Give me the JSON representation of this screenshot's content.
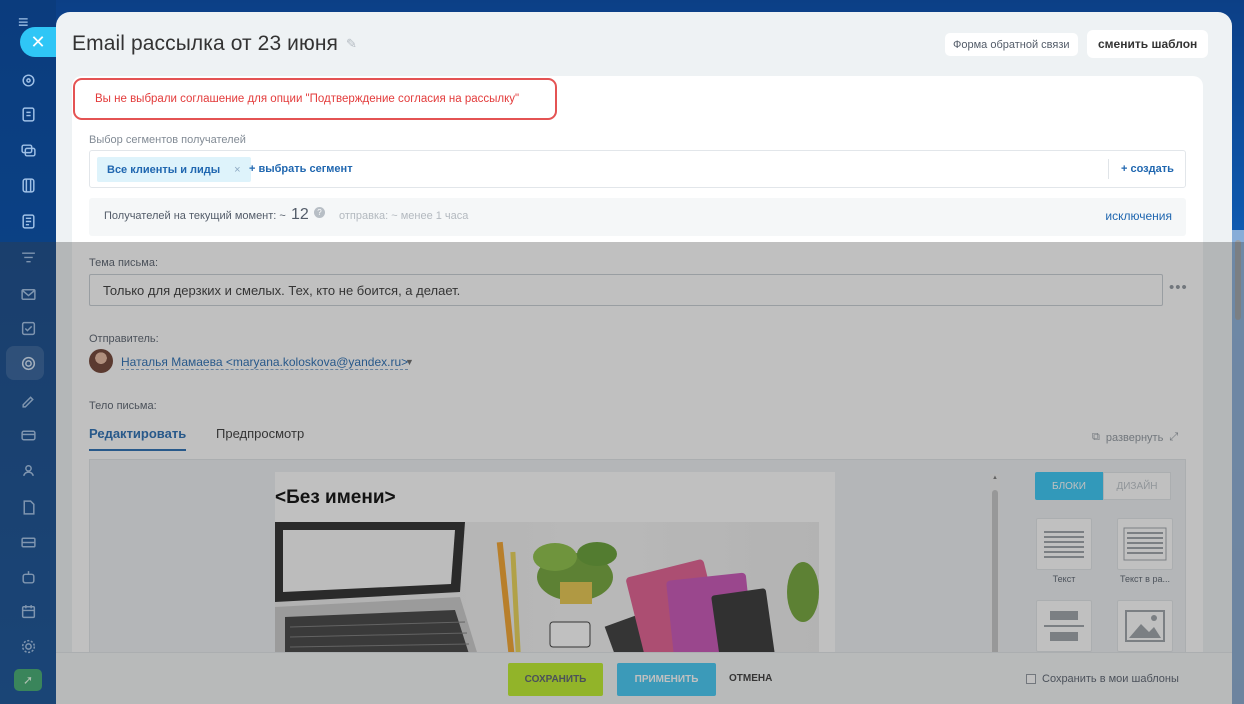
{
  "header": {
    "title": "Email рассылка от 23 июня",
    "feedback_label": "Форма обратной связи",
    "change_template_label": "сменить шаблон"
  },
  "error": {
    "message": "Вы не выбрали соглашение для опции \"Подтверждение согласия на рассылку\""
  },
  "segments": {
    "label": "Выбор сегментов получателей",
    "tag": "Все клиенты и лиды",
    "tag_remove": "×",
    "add": "+ выбрать сегмент",
    "create": "+ создать"
  },
  "recipients": {
    "label": "Получателей на текущий момент: ~",
    "count": "12",
    "send_time": "отправка: ~ менее 1 часа",
    "exclusions": "исключения"
  },
  "subject": {
    "label": "Тема письма:",
    "value": "Только для дерзких и смелых. Тех, кто не боится, а делает."
  },
  "sender": {
    "label": "Отправитель:",
    "value": "Наталья Мамаева <maryana.koloskova@yandex.ru>"
  },
  "body": {
    "label": "Тело письма:",
    "tabs": [
      {
        "label": "Редактировать",
        "active": true
      },
      {
        "label": "Предпросмотр",
        "active": false
      }
    ],
    "expand": "развернуть",
    "email_title": "<Без имени>"
  },
  "designer": {
    "tab_blocks": "БЛОКИ",
    "tab_design": "ДИЗАЙН",
    "blocks": [
      {
        "label": "Текст"
      },
      {
        "label": "Текст в ра..."
      }
    ]
  },
  "footer": {
    "save": "СОХРАНИТЬ",
    "apply": "ПРИМЕНИТЬ",
    "cancel": "ОТМЕНА",
    "save_template": "Сохранить в мои шаблоны"
  },
  "colors": {
    "accent": "#2fc6f6",
    "save": "#bbed21",
    "error": "#e45353",
    "link": "#2067b0"
  }
}
